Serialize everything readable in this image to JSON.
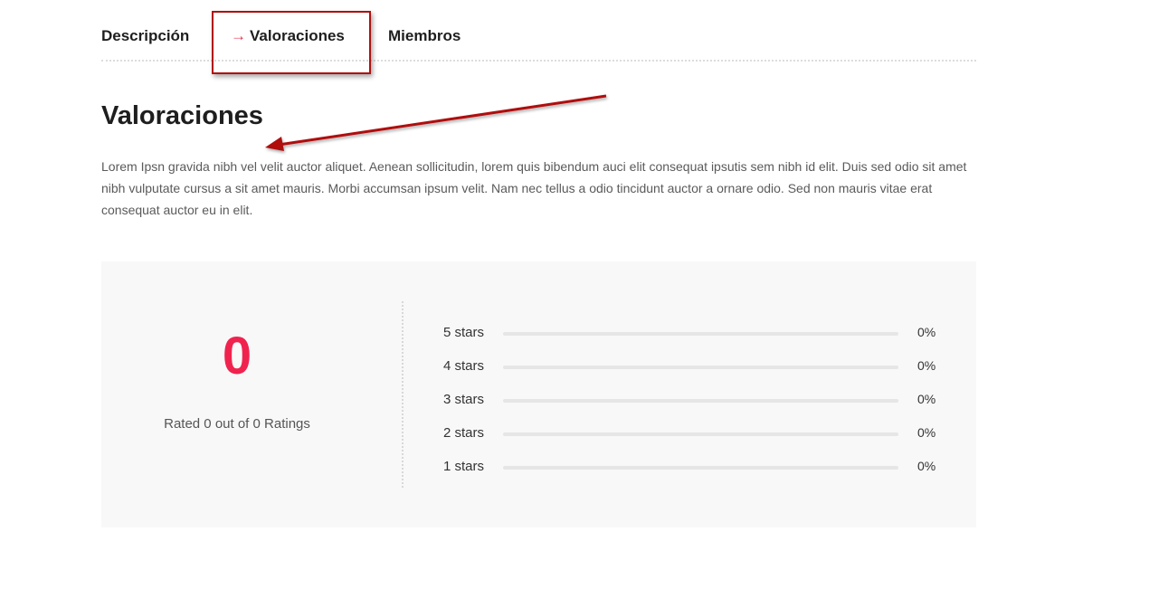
{
  "tabs": {
    "descripcion": "Descripción",
    "valoraciones_arrow": "→",
    "valoraciones": "Valoraciones",
    "miembros": "Miembros",
    "active": "valoraciones"
  },
  "section": {
    "title": "Valoraciones",
    "description": "Lorem Ipsn gravida nibh vel velit auctor aliquet. Aenean sollicitudin, lorem quis bibendum auci elit consequat ipsutis sem nibh id elit. Duis sed odio sit amet nibh vulputate cursus a sit amet mauris. Morbi accumsan ipsum velit. Nam nec tellus a odio tincidunt auctor a ornare odio. Sed non mauris vitae erat consequat auctor eu in elit."
  },
  "ratings": {
    "score": "0",
    "rated_text": "Rated 0 out of 0 Ratings",
    "rows": [
      {
        "label": "5 stars",
        "percent": "0%",
        "fraction": 0
      },
      {
        "label": "4 stars",
        "percent": "0%",
        "fraction": 0
      },
      {
        "label": "3 stars",
        "percent": "0%",
        "fraction": 0
      },
      {
        "label": "2 stars",
        "percent": "0%",
        "fraction": 0
      },
      {
        "label": "1 stars",
        "percent": "0%",
        "fraction": 0
      }
    ]
  },
  "colors": {
    "accent": "#f0234e",
    "annotation": "#b01010"
  },
  "icons": {
    "tab_arrow": "arrow-right-icon",
    "annotation": "annotation-arrow-icon"
  }
}
